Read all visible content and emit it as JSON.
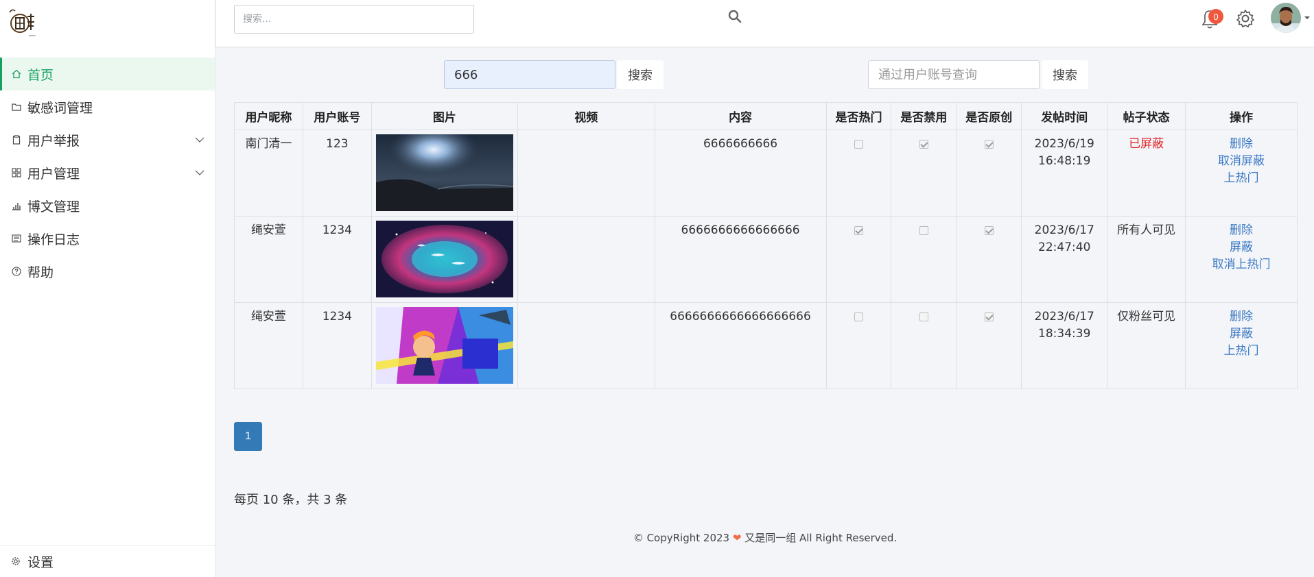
{
  "sidebar": {
    "items": [
      {
        "label": "首页",
        "icon": "home-icon",
        "active": true
      },
      {
        "label": "敏感词管理",
        "icon": "folder-icon"
      },
      {
        "label": "用户举报",
        "icon": "clipboard-icon",
        "expandable": true
      },
      {
        "label": "用户管理",
        "icon": "grid-icon",
        "expandable": true
      },
      {
        "label": "博文管理",
        "icon": "bar-chart-icon"
      },
      {
        "label": "操作日志",
        "icon": "list-icon"
      },
      {
        "label": "帮助",
        "icon": "help-circle-icon"
      }
    ],
    "settings_label": "设置"
  },
  "header": {
    "search_placeholder": "搜索...",
    "notification_count": "0"
  },
  "filters": {
    "search_value": "666",
    "search_button": "搜索",
    "account_placeholder": "通过用户账号查询",
    "account_button": "搜索"
  },
  "table": {
    "columns": [
      "用户昵称",
      "用户账号",
      "图片",
      "视频",
      "内容",
      "是否热门",
      "是否禁用",
      "是否原创",
      "发帖时间",
      "帖子状态",
      "操作"
    ],
    "rows": [
      {
        "nickname": "南门清一",
        "account": "123",
        "video": "",
        "content": "6666666666",
        "hot": false,
        "disabled": true,
        "original": true,
        "date": "2023/6/19",
        "time": "16:48:19",
        "status": "已屏蔽",
        "actions": [
          "删除",
          "取消屏蔽",
          "上热门"
        ]
      },
      {
        "nickname": "绳安萱",
        "account": "1234",
        "video": "",
        "content": "6666666666666666",
        "hot": true,
        "disabled": false,
        "original": true,
        "date": "2023/6/17",
        "time": "22:47:40",
        "status": "所有人可见",
        "actions": [
          "删除",
          "屏蔽",
          "取消上热门"
        ]
      },
      {
        "nickname": "绳安萱",
        "account": "1234",
        "video": "",
        "content": "6666666666666666666",
        "hot": false,
        "disabled": false,
        "original": true,
        "date": "2023/6/17",
        "time": "18:34:39",
        "status": "仅粉丝可见",
        "actions": [
          "删除",
          "屏蔽",
          "上热门"
        ]
      }
    ]
  },
  "pagination": {
    "current_page": "1",
    "info": "每页 10 条，共 3 条"
  },
  "footer": {
    "prefix": "© CopyRight 2023 ",
    "heart": "❤",
    "suffix": " 又是同一组 All Right Reserved."
  },
  "colors": {
    "accent_green": "#19a060",
    "link_blue": "#3a78c3",
    "page_blue": "#337ab7",
    "status_red": "#e02020",
    "badge_red": "#f0573f"
  }
}
